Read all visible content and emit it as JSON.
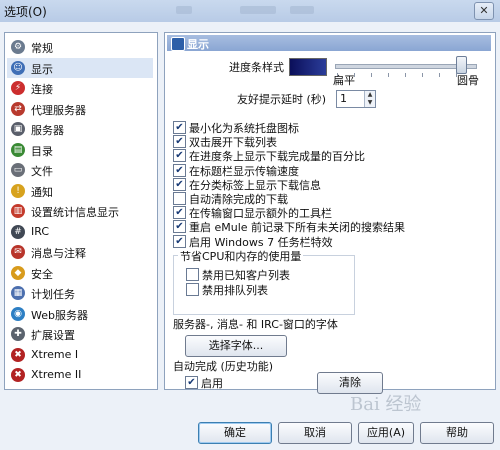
{
  "window": {
    "title": "选项(O)",
    "close_glyph": "✕"
  },
  "sidebar": {
    "items": [
      {
        "label": "常规",
        "icon": "wrench-icon",
        "color": "#6b7b8f",
        "glyph": "⚙"
      },
      {
        "label": "显示",
        "icon": "person-icon",
        "color": "#3f6fb6",
        "glyph": "☺",
        "selected": true
      },
      {
        "label": "连接",
        "icon": "plug-icon",
        "color": "#cc2e2e",
        "glyph": "⚡"
      },
      {
        "label": "代理服务器",
        "icon": "proxy-icon",
        "color": "#b83a2e",
        "glyph": "⇄"
      },
      {
        "label": "服务器",
        "icon": "server-icon",
        "color": "#5a5f6b",
        "glyph": "▣"
      },
      {
        "label": "目录",
        "icon": "folder-icon",
        "color": "#3a8a35",
        "glyph": "▤"
      },
      {
        "label": "文件",
        "icon": "file-icon",
        "color": "#6a6f78",
        "glyph": "▭"
      },
      {
        "label": "通知",
        "icon": "notification-icon",
        "color": "#d7a21e",
        "glyph": "!"
      },
      {
        "label": "设置统计信息显示",
        "icon": "statistics-icon",
        "color": "#c43b2c",
        "glyph": "▥"
      },
      {
        "label": "IRC",
        "icon": "irc-icon",
        "color": "#404854",
        "glyph": "#"
      },
      {
        "label": "消息与注释",
        "icon": "messages-icon",
        "color": "#b8352b",
        "glyph": "✉"
      },
      {
        "label": "安全",
        "icon": "lock-icon",
        "color": "#d89b1c",
        "glyph": "◆"
      },
      {
        "label": "计划任务",
        "icon": "calendar-icon",
        "color": "#4c6fae",
        "glyph": "▦"
      },
      {
        "label": "Web服务器",
        "icon": "globe-icon",
        "color": "#2d7fc4",
        "glyph": "◉"
      },
      {
        "label": "扩展设置",
        "icon": "extension-icon",
        "color": "#5b636e",
        "glyph": "✚"
      },
      {
        "label": "Xtreme I",
        "icon": "xtreme-icon",
        "color": "#b22323",
        "glyph": "✖"
      },
      {
        "label": "Xtreme II",
        "icon": "xtreme-icon",
        "color": "#b22323",
        "glyph": "✖"
      }
    ]
  },
  "panel": {
    "header": "显示",
    "progress_style_label": "进度条样式",
    "slider_left_label": "扁平",
    "slider_right_label": "圆骨",
    "slider_value": 0.9,
    "tooltip_delay_label": "友好提示延时 (秒)",
    "tooltip_delay_value": "1",
    "checkboxes": [
      {
        "label": "最小化为系统托盘图标",
        "checked": true
      },
      {
        "label": "双击展开下载列表",
        "checked": true
      },
      {
        "label": "在进度条上显示下载完成量的百分比",
        "checked": true
      },
      {
        "label": "在标题栏显示传输速度",
        "checked": true
      },
      {
        "label": "在分类标签上显示下载信息",
        "checked": true
      },
      {
        "label": "自动清除完成的下载",
        "checked": false
      },
      {
        "label": "在传输窗口显示额外的工具栏",
        "checked": true
      },
      {
        "label": "重启 eMule 前记录下所有未关闭的搜索结果",
        "checked": true
      },
      {
        "label": "启用 Windows 7 任务栏特效",
        "checked": true
      }
    ],
    "cpu_group": {
      "legend": "节省CPU和内存的使用量",
      "options": [
        {
          "label": "禁用已知客户列表",
          "checked": false
        },
        {
          "label": "禁用排队列表",
          "checked": false
        }
      ]
    },
    "font_label": "服务器-, 消息- 和 IRC-窗口的字体",
    "font_button": "选择字体...",
    "autocomplete_label": "自动完成 (历史功能)",
    "enable_label": "启用",
    "enable_checked": true,
    "clear_button": "清除"
  },
  "footer": {
    "ok": "确定",
    "cancel": "取消",
    "apply": "应用(A)",
    "help": "帮助"
  }
}
